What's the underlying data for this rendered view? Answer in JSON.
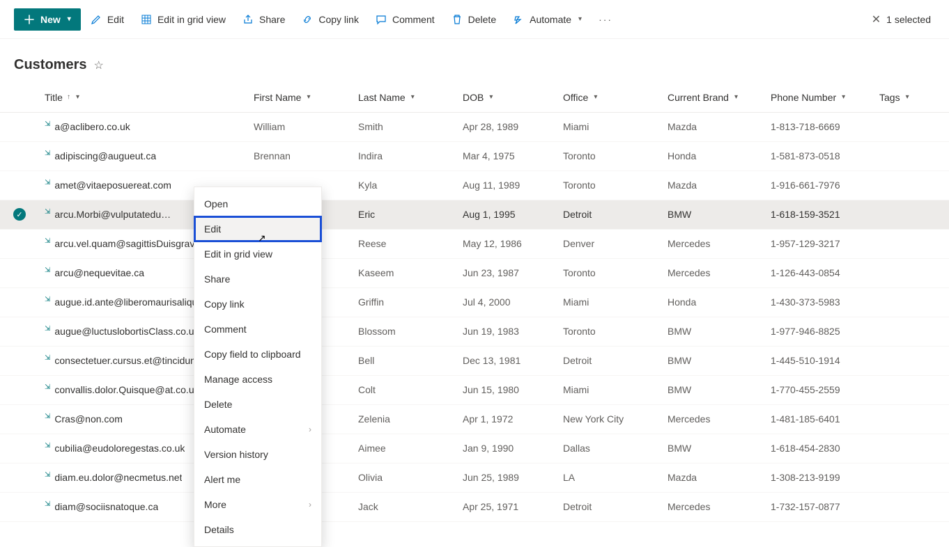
{
  "toolbar": {
    "new_label": "New",
    "edit_label": "Edit",
    "grid_label": "Edit in grid view",
    "share_label": "Share",
    "copylink_label": "Copy link",
    "comment_label": "Comment",
    "delete_label": "Delete",
    "automate_label": "Automate",
    "selected_text": "1 selected"
  },
  "page": {
    "title": "Customers"
  },
  "columns": {
    "title": "Title",
    "first_name": "First Name",
    "last_name": "Last Name",
    "dob": "DOB",
    "office": "Office",
    "brand": "Current Brand",
    "phone": "Phone Number",
    "tags": "Tags"
  },
  "rows": [
    {
      "title": "a@aclibero.co.uk",
      "first_name": "William",
      "last_name": "Smith",
      "dob": "Apr 28, 1989",
      "office": "Miami",
      "brand": "Mazda",
      "phone": "1-813-718-6669",
      "selected": false
    },
    {
      "title": "adipiscing@augueut.ca",
      "first_name": "Brennan",
      "last_name": "Indira",
      "dob": "Mar 4, 1975",
      "office": "Toronto",
      "brand": "Honda",
      "phone": "1-581-873-0518",
      "selected": false
    },
    {
      "title": "amet@vitaeposuereat.com",
      "first_name": "",
      "last_name": "Kyla",
      "dob": "Aug 11, 1989",
      "office": "Toronto",
      "brand": "Mazda",
      "phone": "1-916-661-7976",
      "selected": false
    },
    {
      "title": "arcu.Morbi@vulputatedu…",
      "first_name": "",
      "last_name": "Eric",
      "dob": "Aug 1, 1995",
      "office": "Detroit",
      "brand": "BMW",
      "phone": "1-618-159-3521",
      "selected": true
    },
    {
      "title": "arcu.vel.quam@sagittisDuisgravid",
      "first_name": "",
      "last_name": "Reese",
      "dob": "May 12, 1986",
      "office": "Denver",
      "brand": "Mercedes",
      "phone": "1-957-129-3217",
      "selected": false
    },
    {
      "title": "arcu@nequevitae.ca",
      "first_name": "",
      "last_name": "Kaseem",
      "dob": "Jun 23, 1987",
      "office": "Toronto",
      "brand": "Mercedes",
      "phone": "1-126-443-0854",
      "selected": false
    },
    {
      "title": "augue.id.ante@liberomaurisaliqua",
      "first_name": "",
      "last_name": "Griffin",
      "dob": "Jul 4, 2000",
      "office": "Miami",
      "brand": "Honda",
      "phone": "1-430-373-5983",
      "selected": false
    },
    {
      "title": "augue@luctuslobortisClass.co.uk",
      "first_name": "",
      "last_name": "Blossom",
      "dob": "Jun 19, 1983",
      "office": "Toronto",
      "brand": "BMW",
      "phone": "1-977-946-8825",
      "selected": false
    },
    {
      "title": "consectetuer.cursus.et@tinciduntD",
      "first_name": "",
      "last_name": "Bell",
      "dob": "Dec 13, 1981",
      "office": "Detroit",
      "brand": "BMW",
      "phone": "1-445-510-1914",
      "selected": false
    },
    {
      "title": "convallis.dolor.Quisque@at.co.uk",
      "first_name": "",
      "last_name": "Colt",
      "dob": "Jun 15, 1980",
      "office": "Miami",
      "brand": "BMW",
      "phone": "1-770-455-2559",
      "selected": false
    },
    {
      "title": "Cras@non.com",
      "first_name": "",
      "last_name": "Zelenia",
      "dob": "Apr 1, 1972",
      "office": "New York City",
      "brand": "Mercedes",
      "phone": "1-481-185-6401",
      "selected": false
    },
    {
      "title": "cubilia@eudoloregestas.co.uk",
      "first_name": "",
      "last_name": "Aimee",
      "dob": "Jan 9, 1990",
      "office": "Dallas",
      "brand": "BMW",
      "phone": "1-618-454-2830",
      "selected": false
    },
    {
      "title": "diam.eu.dolor@necmetus.net",
      "first_name": "",
      "last_name": "Olivia",
      "dob": "Jun 25, 1989",
      "office": "LA",
      "brand": "Mazda",
      "phone": "1-308-213-9199",
      "selected": false
    },
    {
      "title": "diam@sociisnatoque.ca",
      "first_name": "",
      "last_name": "Jack",
      "dob": "Apr 25, 1971",
      "office": "Detroit",
      "brand": "Mercedes",
      "phone": "1-732-157-0877",
      "selected": false
    }
  ],
  "context_menu": {
    "items": [
      {
        "label": "Open"
      },
      {
        "label": "Edit",
        "highlight": true,
        "cursor": true
      },
      {
        "label": "Edit in grid view"
      },
      {
        "label": "Share"
      },
      {
        "label": "Copy link"
      },
      {
        "label": "Comment"
      },
      {
        "label": "Copy field to clipboard"
      },
      {
        "label": "Manage access"
      },
      {
        "label": "Delete"
      },
      {
        "label": "Automate",
        "submenu": true
      },
      {
        "label": "Version history"
      },
      {
        "label": "Alert me"
      },
      {
        "label": "More",
        "submenu": true
      },
      {
        "label": "Details"
      }
    ]
  }
}
